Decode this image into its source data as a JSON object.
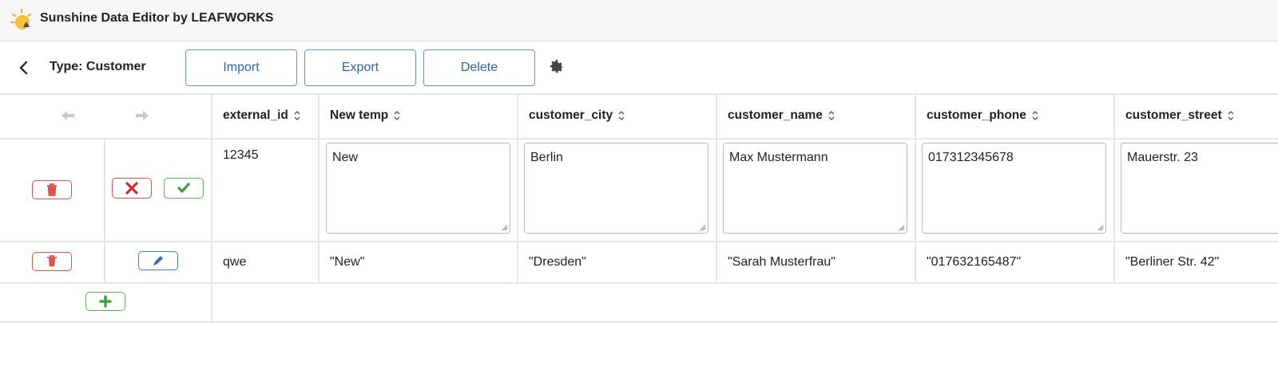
{
  "app": {
    "title": "Sunshine Data Editor by LEAFWORKS"
  },
  "toolbar": {
    "type_label": "Type: Customer",
    "import_label": "Import",
    "export_label": "Export",
    "delete_label": "Delete"
  },
  "table": {
    "columns": [
      "external_id",
      "New temp",
      "customer_city",
      "customer_name",
      "customer_phone",
      "customer_street"
    ],
    "edit_row": [
      "12345",
      "New",
      "Berlin",
      "Max Mustermann",
      "017312345678",
      "Mauerstr. 23"
    ],
    "rows": [
      [
        "qwe",
        "\"New\"",
        "\"Dresden\"",
        "\"Sarah Musterfrau\"",
        "\"017632165487\"",
        "\"Berliner Str. 42\""
      ]
    ]
  },
  "icons": {
    "logo": "sun-icon",
    "back": "chevron-left-icon",
    "settings": "gear-icon",
    "nav_prev": "arrow-left-icon",
    "nav_next": "arrow-right-icon",
    "delete_row": "trash-icon",
    "cancel": "x-icon",
    "confirm": "check-icon",
    "edit": "pencil-icon",
    "add": "plus-icon",
    "sort": "sort-icon"
  },
  "colors": {
    "accent_blue": "#2f63a8",
    "danger_red": "#d9534f",
    "success_green": "#5cb85c"
  }
}
